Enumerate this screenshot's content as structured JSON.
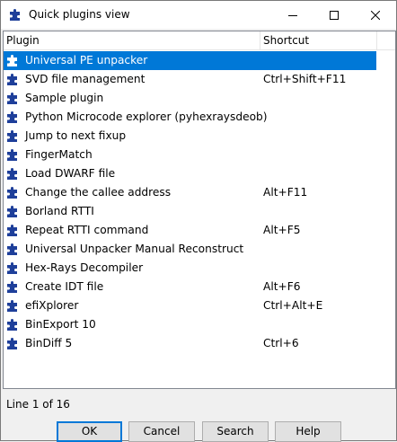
{
  "window": {
    "title": "Quick plugins view",
    "icon": "plugin-icon",
    "controls": [
      "minimize-icon",
      "maximize-icon",
      "close-icon"
    ]
  },
  "list": {
    "columns": {
      "plugin": "Plugin",
      "shortcut": "Shortcut"
    },
    "selected_index": 0,
    "rows": [
      {
        "name": "Universal PE unpacker",
        "shortcut": ""
      },
      {
        "name": "SVD file management",
        "shortcut": "Ctrl+Shift+F11"
      },
      {
        "name": "Sample plugin",
        "shortcut": ""
      },
      {
        "name": "Python Microcode explorer (pyhexraysdeob)",
        "shortcut": ""
      },
      {
        "name": "Jump to next fixup",
        "shortcut": ""
      },
      {
        "name": "FingerMatch",
        "shortcut": ""
      },
      {
        "name": "Load DWARF file",
        "shortcut": ""
      },
      {
        "name": "Change the callee address",
        "shortcut": "Alt+F11"
      },
      {
        "name": "Borland RTTI",
        "shortcut": ""
      },
      {
        "name": "Repeat RTTI command",
        "shortcut": "Alt+F5"
      },
      {
        "name": "Universal Unpacker Manual Reconstruct",
        "shortcut": ""
      },
      {
        "name": "Hex-Rays Decompiler",
        "shortcut": ""
      },
      {
        "name": "Create IDT file",
        "shortcut": "Alt+F6"
      },
      {
        "name": "efiXplorer",
        "shortcut": "Ctrl+Alt+E"
      },
      {
        "name": "BinExport 10",
        "shortcut": ""
      },
      {
        "name": "BinDiff 5",
        "shortcut": "Ctrl+6"
      }
    ]
  },
  "status": {
    "text": "Line 1 of 16"
  },
  "buttons": {
    "ok": "OK",
    "cancel": "Cancel",
    "search": "Search",
    "help": "Help"
  },
  "colors": {
    "selection": "#0078d7",
    "plugin_icon": "#1e3f9a"
  }
}
